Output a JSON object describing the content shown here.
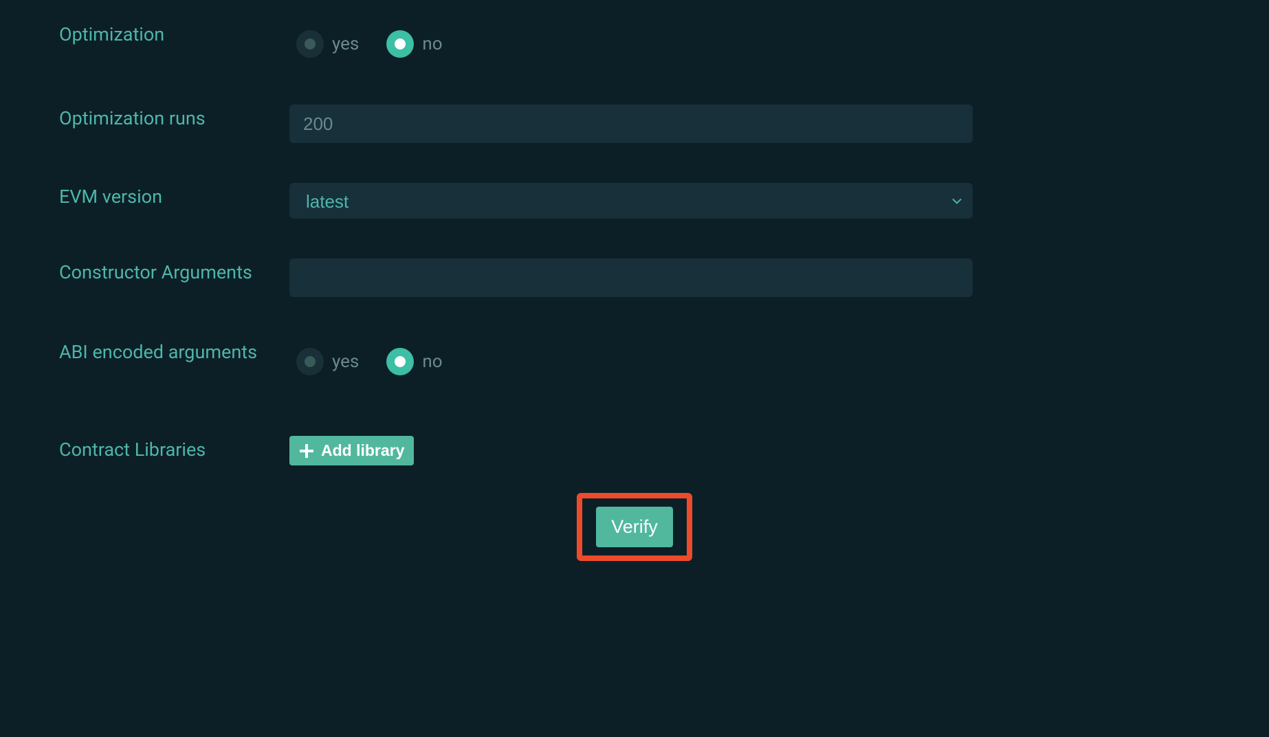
{
  "form": {
    "optimization": {
      "label": "Optimization",
      "yes_label": "yes",
      "no_label": "no",
      "selected": "no"
    },
    "optimization_runs": {
      "label": "Optimization runs",
      "placeholder": "200",
      "value": ""
    },
    "evm_version": {
      "label": "EVM version",
      "selected": "latest"
    },
    "constructor_arguments": {
      "label": "Constructor Arguments",
      "value": ""
    },
    "abi_encoded": {
      "label": "ABI encoded arguments",
      "yes_label": "yes",
      "no_label": "no",
      "selected": "no"
    },
    "contract_libraries": {
      "label": "Contract Libraries",
      "add_button": "Add library"
    },
    "verify_button": "Verify"
  }
}
